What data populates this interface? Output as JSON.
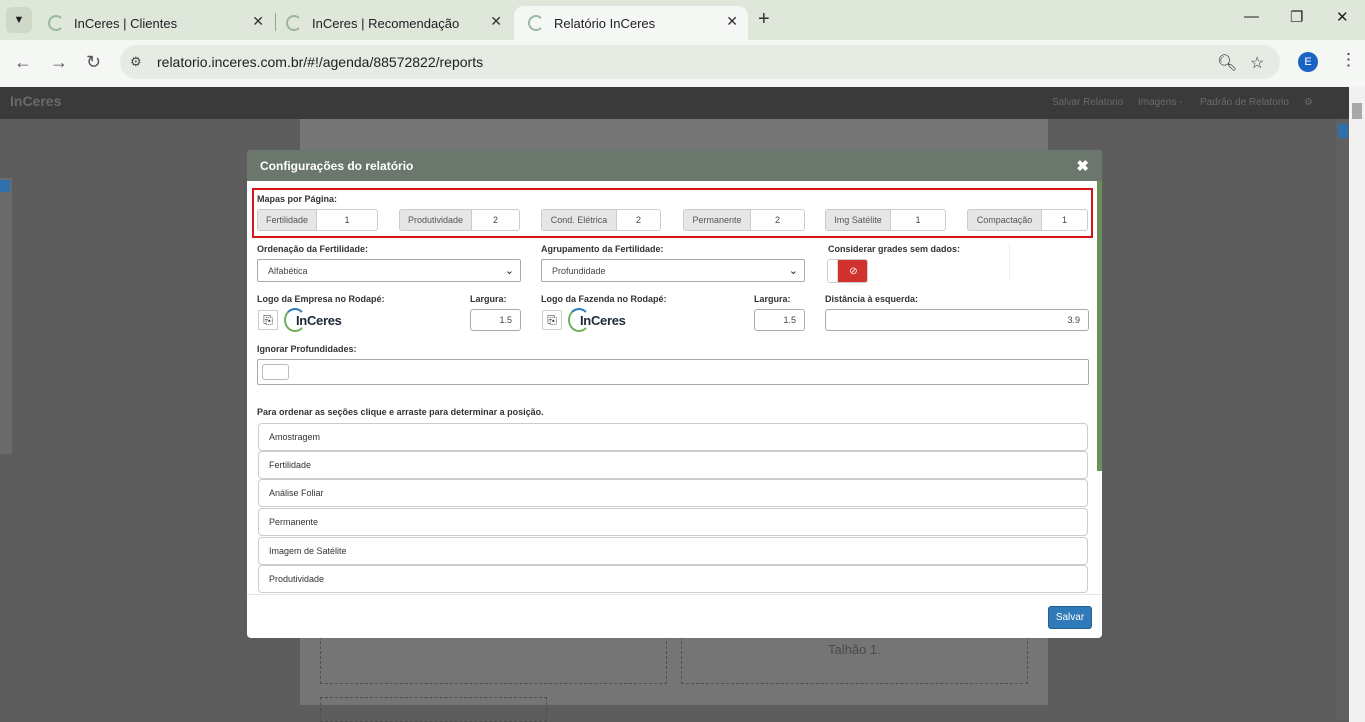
{
  "browser": {
    "tabs": [
      {
        "title": "InCeres | Clientes"
      },
      {
        "title": "InCeres | Recomendação"
      },
      {
        "title": "Relatório InCeres"
      }
    ],
    "url": "relatorio.inceres.com.br/#!/agenda/88572822/reports",
    "profile_initial": "E"
  },
  "app_header": {
    "logo": "InCeres",
    "menu": [
      "Salvar Relatorio",
      "Imagens -",
      "Padrão de Relatorio"
    ]
  },
  "background": {
    "talhao": "Talhão 1."
  },
  "modal": {
    "title": "Configurações do relatório",
    "maps_per_page": {
      "label": "Mapas por Página:",
      "items": [
        {
          "label": "Fertilidade",
          "value": "1"
        },
        {
          "label": "Produtividade",
          "value": "2"
        },
        {
          "label": "Cond. Elétrica",
          "value": "2"
        },
        {
          "label": "Permanente",
          "value": "2"
        },
        {
          "label": "Img Satélite",
          "value": "1"
        },
        {
          "label": "Compactação",
          "value": "1"
        }
      ]
    },
    "ordering": {
      "label": "Ordenação da Fertilidade:",
      "value": "Alfabética"
    },
    "grouping": {
      "label": "Agrupamento da Fertilidade:",
      "value": "Profundidade"
    },
    "empty_grids": {
      "label": "Considerar grades sem dados:",
      "state": "off"
    },
    "company_logo": {
      "label": "Logo da Empresa no Rodapé:",
      "logo_text": "InCeres"
    },
    "company_width": {
      "label": "Largura:",
      "value": "1.5"
    },
    "farm_logo": {
      "label": "Logo da Fazenda no Rodapé:",
      "logo_text": "InCeres"
    },
    "farm_width": {
      "label": "Largura:",
      "value": "1.5"
    },
    "left_distance": {
      "label": "Distância à esquerda:",
      "value": "3.9"
    },
    "ignore_depths": {
      "label": "Ignorar Profundidades:"
    },
    "sections_hint": "Para ordenar as seções clique e arraste para determinar a posição.",
    "sections": [
      "Amostragem",
      "Fertilidade",
      "Análise Foliar",
      "Permanente",
      "Imagem de Satélite",
      "Produtividade"
    ],
    "save_label": "Salvar"
  },
  "colors": {
    "header": "#6b776d",
    "highlight": "#d9141b",
    "toggle_off": "#d2322d",
    "save": "#2f7ab8"
  }
}
